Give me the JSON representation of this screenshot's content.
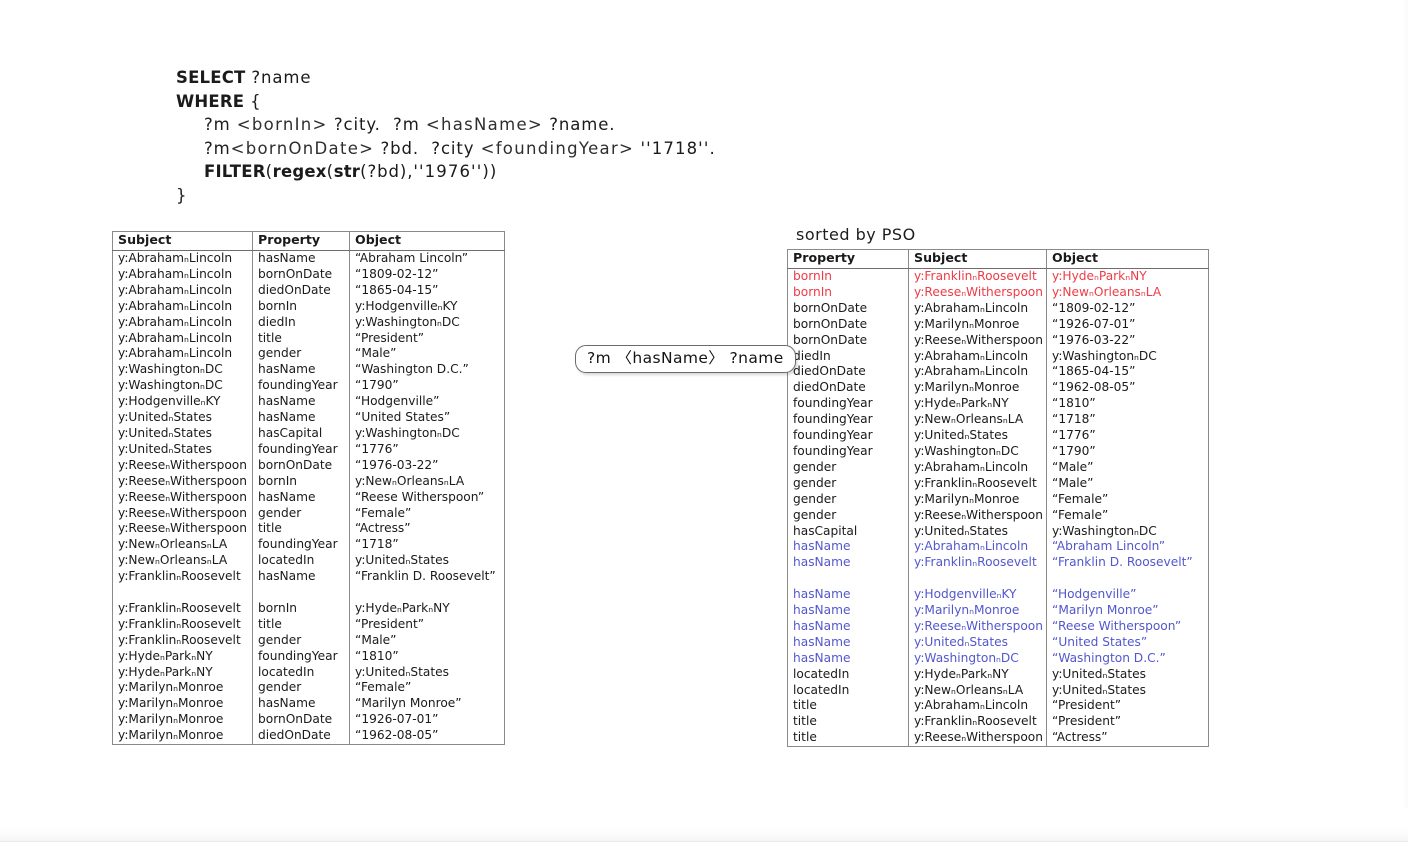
{
  "query": {
    "lines": [
      {
        "parts": [
          {
            "t": "SELECT",
            "cls": "kw"
          },
          {
            "t": " ",
            "cls": ""
          },
          {
            "t": "?name",
            "cls": "var"
          }
        ],
        "indent": 0
      },
      {
        "parts": [
          {
            "t": "WHERE",
            "cls": "kw"
          },
          {
            "t": " {",
            "cls": ""
          }
        ],
        "indent": 0
      },
      {
        "parts": [
          {
            "t": "?m ",
            "cls": "var"
          },
          {
            "t": "<bornIn>",
            "cls": "iri"
          },
          {
            "t": " ?city.  ?m ",
            "cls": "var"
          },
          {
            "t": "<hasName>",
            "cls": "iri"
          },
          {
            "t": " ?name.",
            "cls": "var"
          }
        ],
        "indent": 1
      },
      {
        "parts": [
          {
            "t": "?m",
            "cls": "var"
          },
          {
            "t": "<bornOnDate>",
            "cls": "iri"
          },
          {
            "t": " ?bd.  ?city ",
            "cls": "var"
          },
          {
            "t": "<foundingYear>",
            "cls": "iri"
          },
          {
            "t": " ''1718''.",
            "cls": "lit"
          }
        ],
        "indent": 1
      },
      {
        "parts": [
          {
            "t": "FILTER",
            "cls": "kw"
          },
          {
            "t": "(",
            "cls": ""
          },
          {
            "t": "regex",
            "cls": "kw"
          },
          {
            "t": "(",
            "cls": ""
          },
          {
            "t": "str",
            "cls": "kw"
          },
          {
            "t": "(?bd),",
            "cls": "var"
          },
          {
            "t": "''1976''))",
            "cls": "lit"
          }
        ],
        "indent": 1
      },
      {
        "parts": [
          {
            "t": "}",
            "cls": ""
          }
        ],
        "indent": 0
      }
    ]
  },
  "bubble": {
    "text": "?m 〈hasName〉 ?name"
  },
  "pso_caption": "sorted by PSO",
  "colors": {
    "highlight_red": "#ee3c46",
    "highlight_blue": "#5257cd",
    "table_border": "#8a8a8a",
    "text": "#1a1a1a"
  },
  "spo_table": {
    "headers": [
      "Subject",
      "Property",
      "Object"
    ],
    "rows": [
      {
        "cells": [
          "y:AbrahamₙLincoln",
          "hasName",
          "“Abraham Lincoln”"
        ],
        "style": ""
      },
      {
        "cells": [
          "y:AbrahamₙLincoln",
          "bornOnDate",
          "“1809-02-12”"
        ],
        "style": ""
      },
      {
        "cells": [
          "y:AbrahamₙLincoln",
          "diedOnDate",
          "“1865-04-15”"
        ],
        "style": ""
      },
      {
        "cells": [
          "y:AbrahamₙLincoln",
          "bornIn",
          "y:HodgenvilleₙKY"
        ],
        "style": ""
      },
      {
        "cells": [
          "y:AbrahamₙLincoln",
          "diedIn",
          "y:WashingtonₙDC"
        ],
        "style": ""
      },
      {
        "cells": [
          "y:AbrahamₙLincoln",
          "title",
          "“President”"
        ],
        "style": ""
      },
      {
        "cells": [
          "y:AbrahamₙLincoln",
          "gender",
          "“Male”"
        ],
        "style": ""
      },
      {
        "cells": [
          "y:WashingtonₙDC",
          "hasName",
          "“Washington D.C.”"
        ],
        "style": ""
      },
      {
        "cells": [
          "y:WashingtonₙDC",
          "foundingYear",
          "“1790”"
        ],
        "style": ""
      },
      {
        "cells": [
          "y:HodgenvilleₙKY",
          "hasName",
          "“Hodgenville”"
        ],
        "style": ""
      },
      {
        "cells": [
          "y:UnitedₙStates",
          "hasName",
          "“United States”"
        ],
        "style": ""
      },
      {
        "cells": [
          "y:UnitedₙStates",
          "hasCapital",
          "y:WashingtonₙDC"
        ],
        "style": ""
      },
      {
        "cells": [
          "y:UnitedₙStates",
          "foundingYear",
          "“1776”"
        ],
        "style": ""
      },
      {
        "cells": [
          "y:ReeseₙWitherspoon",
          "bornOnDate",
          "“1976-03-22”"
        ],
        "style": ""
      },
      {
        "cells": [
          "y:ReeseₙWitherspoon",
          "bornIn",
          "y:NewₙOrleansₙLA"
        ],
        "style": ""
      },
      {
        "cells": [
          "y:ReeseₙWitherspoon",
          "hasName",
          "“Reese Witherspoon”"
        ],
        "style": ""
      },
      {
        "cells": [
          "y:ReeseₙWitherspoon",
          "gender",
          "“Female”"
        ],
        "style": ""
      },
      {
        "cells": [
          "y:ReeseₙWitherspoon",
          "title",
          "“Actress”"
        ],
        "style": ""
      },
      {
        "cells": [
          "y:NewₙOrleansₙLA",
          "foundingYear",
          "“1718”"
        ],
        "style": ""
      },
      {
        "cells": [
          "y:NewₙOrleansₙLA",
          "locatedIn",
          "y:UnitedₙStates"
        ],
        "style": ""
      },
      {
        "cells": [
          "y:FranklinₙRoosevelt",
          "hasName",
          "“Franklin D. Roosevelt”"
        ],
        "style": "wrap"
      },
      {
        "cells": [
          "y:FranklinₙRoosevelt",
          "bornIn",
          "y:HydeₙParkₙNY"
        ],
        "style": ""
      },
      {
        "cells": [
          "y:FranklinₙRoosevelt",
          "title",
          "“President”"
        ],
        "style": ""
      },
      {
        "cells": [
          "y:FranklinₙRoosevelt",
          "gender",
          "“Male”"
        ],
        "style": ""
      },
      {
        "cells": [
          "y:HydeₙParkₙNY",
          "foundingYear",
          "“1810”"
        ],
        "style": ""
      },
      {
        "cells": [
          "y:HydeₙParkₙNY",
          "locatedIn",
          "y:UnitedₙStates"
        ],
        "style": ""
      },
      {
        "cells": [
          "y:MarilynₙMonroe",
          "gender",
          "“Female”"
        ],
        "style": ""
      },
      {
        "cells": [
          "y:MarilynₙMonroe",
          "hasName",
          "“Marilyn Monroe”"
        ],
        "style": ""
      },
      {
        "cells": [
          "y:MarilynₙMonroe",
          "bornOnDate",
          "“1926-07-01”"
        ],
        "style": ""
      },
      {
        "cells": [
          "y:MarilynₙMonroe",
          "diedOnDate",
          "“1962-08-05”"
        ],
        "style": ""
      }
    ]
  },
  "pso_table": {
    "headers": [
      "Property",
      "Subject",
      "Object"
    ],
    "rows": [
      {
        "cells": [
          "bornIn",
          "y:FranklinₙRoosevelt",
          "y:HydeₙParkₙNY"
        ],
        "style": "red"
      },
      {
        "cells": [
          "bornIn",
          "y:ReeseₙWitherspoon",
          "y:NewₙOrleansₙLA"
        ],
        "style": "red"
      },
      {
        "cells": [
          "bornOnDate",
          "y:AbrahamₙLincoln",
          "“1809-02-12”"
        ],
        "style": ""
      },
      {
        "cells": [
          "bornOnDate",
          "y:MarilynₙMonroe",
          "“1926-07-01”"
        ],
        "style": ""
      },
      {
        "cells": [
          "bornOnDate",
          "y:ReeseₙWitherspoon",
          "“1976-03-22”"
        ],
        "style": ""
      },
      {
        "cells": [
          "diedIn",
          "y:AbrahamₙLincoln",
          "y:WashingtonₙDC"
        ],
        "style": ""
      },
      {
        "cells": [
          "diedOnDate",
          "y:AbrahamₙLincoln",
          "“1865-04-15”"
        ],
        "style": ""
      },
      {
        "cells": [
          "diedOnDate",
          "y:MarilynₙMonroe",
          "“1962-08-05”"
        ],
        "style": ""
      },
      {
        "cells": [
          "foundingYear",
          "y:HydeₙParkₙNY",
          "“1810”"
        ],
        "style": ""
      },
      {
        "cells": [
          "foundingYear",
          "y:NewₙOrleansₙLA",
          "“1718”"
        ],
        "style": ""
      },
      {
        "cells": [
          "foundingYear",
          "y:UnitedₙStates",
          "“1776”"
        ],
        "style": ""
      },
      {
        "cells": [
          "foundingYear",
          "y:WashingtonₙDC",
          "“1790”"
        ],
        "style": ""
      },
      {
        "cells": [
          "gender",
          "y:AbrahamₙLincoln",
          "“Male”"
        ],
        "style": ""
      },
      {
        "cells": [
          "gender",
          "y:FranklinₙRoosevelt",
          "“Male”"
        ],
        "style": ""
      },
      {
        "cells": [
          "gender",
          "y:MarilynₙMonroe",
          "“Female”"
        ],
        "style": ""
      },
      {
        "cells": [
          "gender",
          "y:ReeseₙWitherspoon",
          "“Female”"
        ],
        "style": ""
      },
      {
        "cells": [
          "hasCapital",
          "y:UnitedₙStates",
          "y:WashingtonₙDC"
        ],
        "style": ""
      },
      {
        "cells": [
          "hasName",
          "y:AbrahamₙLincoln",
          "“Abraham Lincoln”"
        ],
        "style": "blue"
      },
      {
        "cells": [
          "hasName",
          "y:FranklinₙRoosevelt",
          "“Franklin D. Roosevelt”"
        ],
        "style": "blue wrap"
      },
      {
        "cells": [
          "hasName",
          "y:HodgenvilleₙKY",
          "“Hodgenville”"
        ],
        "style": "blue"
      },
      {
        "cells": [
          "hasName",
          "y:MarilynₙMonroe",
          "“Marilyn Monroe”"
        ],
        "style": "blue"
      },
      {
        "cells": [
          "hasName",
          "y:ReeseₙWitherspoon",
          "“Reese Witherspoon”"
        ],
        "style": "blue"
      },
      {
        "cells": [
          "hasName",
          "y:UnitedₙStates",
          "“United States”"
        ],
        "style": "blue"
      },
      {
        "cells": [
          "hasName",
          "y:WashingtonₙDC",
          "“Washington D.C.”"
        ],
        "style": "blue"
      },
      {
        "cells": [
          "locatedIn",
          "y:HydeₙParkₙNY",
          "y:UnitedₙStates"
        ],
        "style": ""
      },
      {
        "cells": [
          "locatedIn",
          "y:NewₙOrleansₙLA",
          "y:UnitedₙStates"
        ],
        "style": ""
      },
      {
        "cells": [
          "title",
          "y:AbrahamₙLincoln",
          "“President”"
        ],
        "style": ""
      },
      {
        "cells": [
          "title",
          "y:FranklinₙRoosevelt",
          "“President”"
        ],
        "style": ""
      },
      {
        "cells": [
          "title",
          "y:ReeseₙWitherspoon",
          "“Actress”"
        ],
        "style": ""
      }
    ]
  }
}
